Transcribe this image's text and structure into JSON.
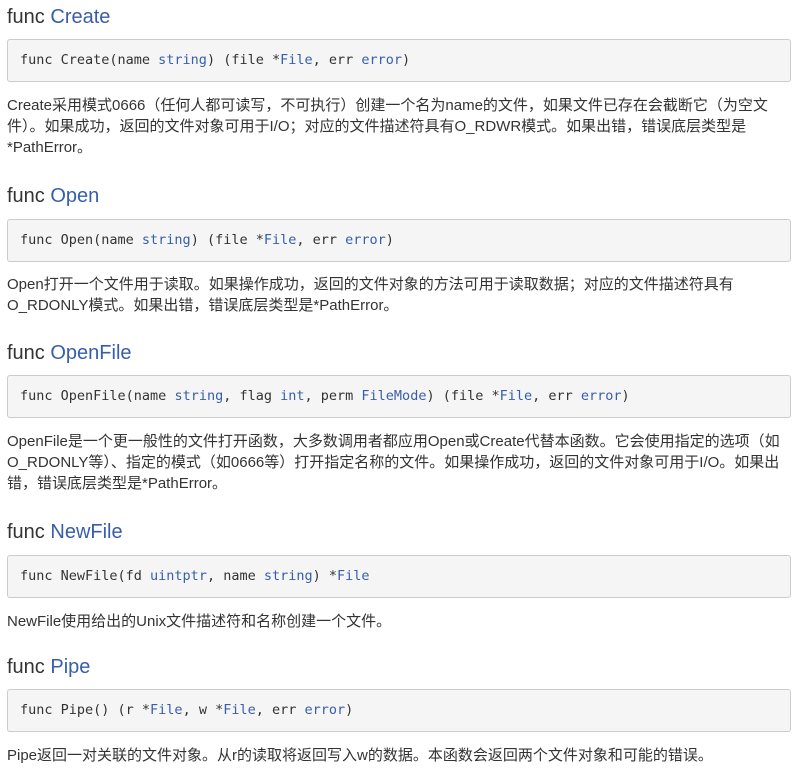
{
  "keyword": "func",
  "functions": [
    {
      "name": "Create",
      "signature": [
        {
          "t": "func Create(name ",
          "type": false
        },
        {
          "t": "string",
          "type": true
        },
        {
          "t": ") (file *",
          "type": false
        },
        {
          "t": "File",
          "type": true
        },
        {
          "t": ", err ",
          "type": false
        },
        {
          "t": "error",
          "type": true
        },
        {
          "t": ")",
          "type": false
        }
      ],
      "description": "Create采用模式0666（任何人都可读写，不可执行）创建一个名为name的文件，如果文件已存在会截断它（为空文件）。如果成功，返回的文件对象可用于I/O；对应的文件描述符具有O_RDWR模式。如果出错，错误底层类型是*PathError。"
    },
    {
      "name": "Open",
      "signature": [
        {
          "t": "func Open(name ",
          "type": false
        },
        {
          "t": "string",
          "type": true
        },
        {
          "t": ") (file *",
          "type": false
        },
        {
          "t": "File",
          "type": true
        },
        {
          "t": ", err ",
          "type": false
        },
        {
          "t": "error",
          "type": true
        },
        {
          "t": ")",
          "type": false
        }
      ],
      "description": "Open打开一个文件用于读取。如果操作成功，返回的文件对象的方法可用于读取数据；对应的文件描述符具有O_RDONLY模式。如果出错，错误底层类型是*PathError。"
    },
    {
      "name": "OpenFile",
      "signature": [
        {
          "t": "func OpenFile(name ",
          "type": false
        },
        {
          "t": "string",
          "type": true
        },
        {
          "t": ", flag ",
          "type": false
        },
        {
          "t": "int",
          "type": true
        },
        {
          "t": ", perm ",
          "type": false
        },
        {
          "t": "FileMode",
          "type": true
        },
        {
          "t": ") (file *",
          "type": false
        },
        {
          "t": "File",
          "type": true
        },
        {
          "t": ", err ",
          "type": false
        },
        {
          "t": "error",
          "type": true
        },
        {
          "t": ")",
          "type": false
        }
      ],
      "description": "OpenFile是一个更一般性的文件打开函数，大多数调用者都应用Open或Create代替本函数。它会使用指定的选项（如O_RDONLY等）、指定的模式（如0666等）打开指定名称的文件。如果操作成功，返回的文件对象可用于I/O。如果出错，错误底层类型是*PathError。"
    },
    {
      "name": "NewFile",
      "signature": [
        {
          "t": "func NewFile(fd ",
          "type": false
        },
        {
          "t": "uintptr",
          "type": true
        },
        {
          "t": ", name ",
          "type": false
        },
        {
          "t": "string",
          "type": true
        },
        {
          "t": ") *",
          "type": false
        },
        {
          "t": "File",
          "type": true
        }
      ],
      "description": "NewFile使用给出的Unix文件描述符和名称创建一个文件。"
    },
    {
      "name": "Pipe",
      "signature": [
        {
          "t": "func Pipe() (r *",
          "type": false
        },
        {
          "t": "File",
          "type": true
        },
        {
          "t": ", w *",
          "type": false
        },
        {
          "t": "File",
          "type": true
        },
        {
          "t": ", err ",
          "type": false
        },
        {
          "t": "error",
          "type": true
        },
        {
          "t": ")",
          "type": false
        }
      ],
      "description": "Pipe返回一对关联的文件对象。从r的读取将返回写入w的数据。本函数会返回两个文件对象和可能的错误。"
    }
  ]
}
